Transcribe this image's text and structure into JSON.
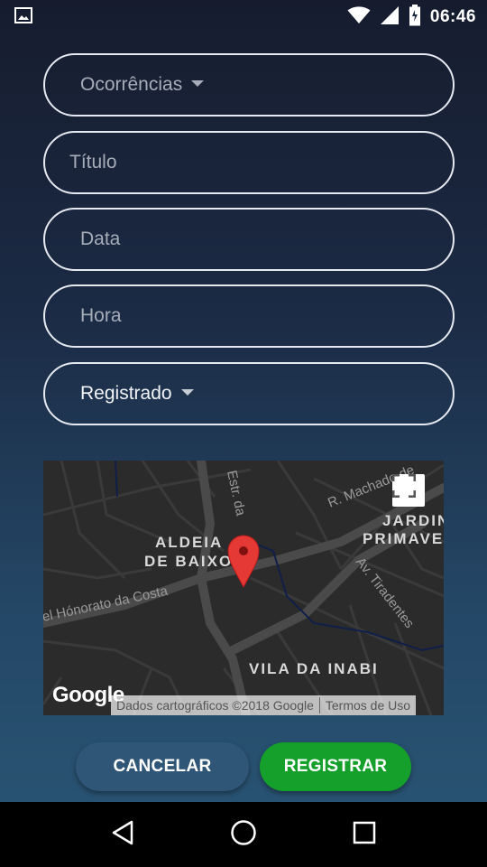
{
  "status_bar": {
    "time": "06:46",
    "icons": [
      "image-icon",
      "wifi-icon",
      "signal-icon",
      "battery-icon"
    ]
  },
  "form": {
    "ocorrencias": {
      "value": "Ocorrências"
    },
    "titulo": {
      "placeholder": "Título"
    },
    "data": {
      "placeholder": "Data"
    },
    "hora": {
      "placeholder": "Hora"
    },
    "status": {
      "value": "Registrado"
    }
  },
  "map": {
    "labels": {
      "aldeia_1": "ALDEIA",
      "aldeia_2": "DE BAIXO",
      "jardim_1": "JARDIN",
      "jardim_2": "PRIMAVE",
      "vila": "VILA DA INABI",
      "honorato": "el Hónorato da Costa",
      "machado": "R. Machado de",
      "estr": "Estr. da",
      "tiradentes": "Av. Tiradentes"
    },
    "logo": "Google",
    "attribution": "Dados cartográficos ©2018 Google",
    "terms": "Termos de Uso"
  },
  "buttons": {
    "cancel": "CANCELAR",
    "register": "REGISTRAR"
  },
  "colors": {
    "register_button": "#14a02a",
    "cancel_button": "#2f5676",
    "marker": "#e53935"
  }
}
